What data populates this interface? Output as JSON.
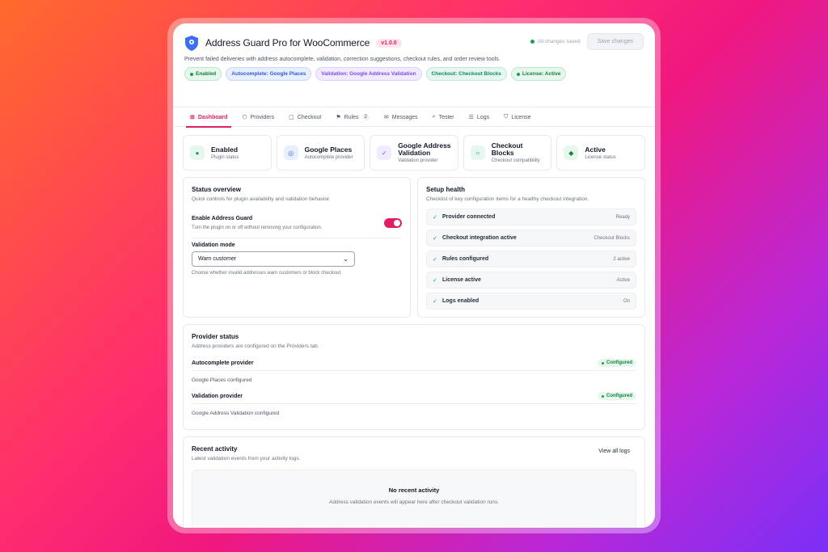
{
  "app": {
    "title": "Address Guard Pro for WooCommerce",
    "version": "v1.0.0",
    "subtitle": "Prevent failed deliveries with address autocomplete, validation, correction suggestions, checkout rules, and order review tools.",
    "saved_status": "All changes saved",
    "save_button": "Save changes"
  },
  "badges": [
    {
      "label": "Enabled"
    },
    {
      "label": "Autocomplete: Google Places"
    },
    {
      "label": "Validation: Google Address Validation"
    },
    {
      "label": "Checkout: Checkout Blocks"
    },
    {
      "label": "License: Active"
    }
  ],
  "tabs": [
    {
      "label": "Dashboard",
      "icon": "grid-icon"
    },
    {
      "label": "Providers",
      "icon": "cube-icon"
    },
    {
      "label": "Checkout",
      "icon": "bag-icon"
    },
    {
      "label": "Rules",
      "icon": "flag-icon",
      "count": "2"
    },
    {
      "label": "Messages",
      "icon": "mail-icon"
    },
    {
      "label": "Tester",
      "icon": "search-icon"
    },
    {
      "label": "Logs",
      "icon": "list-icon"
    },
    {
      "label": "License",
      "icon": "shield-icon"
    }
  ],
  "stats": [
    {
      "title": "Enabled",
      "sub": "Plugin status",
      "icon": "●",
      "color": "#16a34a",
      "bg": "#e7f7ee"
    },
    {
      "title": "Google Places",
      "sub": "Autocomplete provider",
      "icon": "◎",
      "color": "#3b6ef0",
      "bg": "#e8efff"
    },
    {
      "title": "Google Address Validation",
      "sub": "Validation provider",
      "icon": "✓",
      "color": "#7c4ddb",
      "bg": "#f1ebff"
    },
    {
      "title": "Checkout Blocks",
      "sub": "Checkout compatibility",
      "icon": "○",
      "color": "#0f8a62",
      "bg": "#e6f7f1"
    },
    {
      "title": "Active",
      "sub": "License status",
      "icon": "◆",
      "color": "#15803d",
      "bg": "#e7f7ee"
    }
  ],
  "status_overview": {
    "title": "Status overview",
    "desc": "Quick controls for plugin availability and validation behavior.",
    "enable_label": "Enable Address Guard",
    "enable_desc": "Turn the plugin on or off without removing your configuration.",
    "enabled": true,
    "mode_label": "Validation mode",
    "mode_value": "Warn customer",
    "mode_help": "Choose whether invalid addresses warn customers or block checkout."
  },
  "setup_health": {
    "title": "Setup health",
    "desc": "Checklist of key configuration items for a healthy checkout integration.",
    "items": [
      {
        "name": "Provider connected",
        "value": "Ready"
      },
      {
        "name": "Checkout integration active",
        "value": "Checkout Blocks"
      },
      {
        "name": "Rules configured",
        "value": "2 active"
      },
      {
        "name": "License active",
        "value": "Active"
      },
      {
        "name": "Logs enabled",
        "value": "On"
      }
    ]
  },
  "provider_status": {
    "title": "Provider status",
    "desc": "Address providers are configured on the Providers tab.",
    "rows": [
      {
        "label": "Autocomplete provider",
        "status": "Configured",
        "value": "Google Places configured"
      },
      {
        "label": "Validation provider",
        "status": "Configured",
        "value": "Google Address Validation configured"
      }
    ]
  },
  "recent_activity": {
    "title": "Recent activity",
    "desc": "Latest validation events from your activity logs.",
    "view_all": "View all logs",
    "empty_title": "No recent activity",
    "empty_desc": "Address validation events will appear here after checkout validation runs."
  }
}
